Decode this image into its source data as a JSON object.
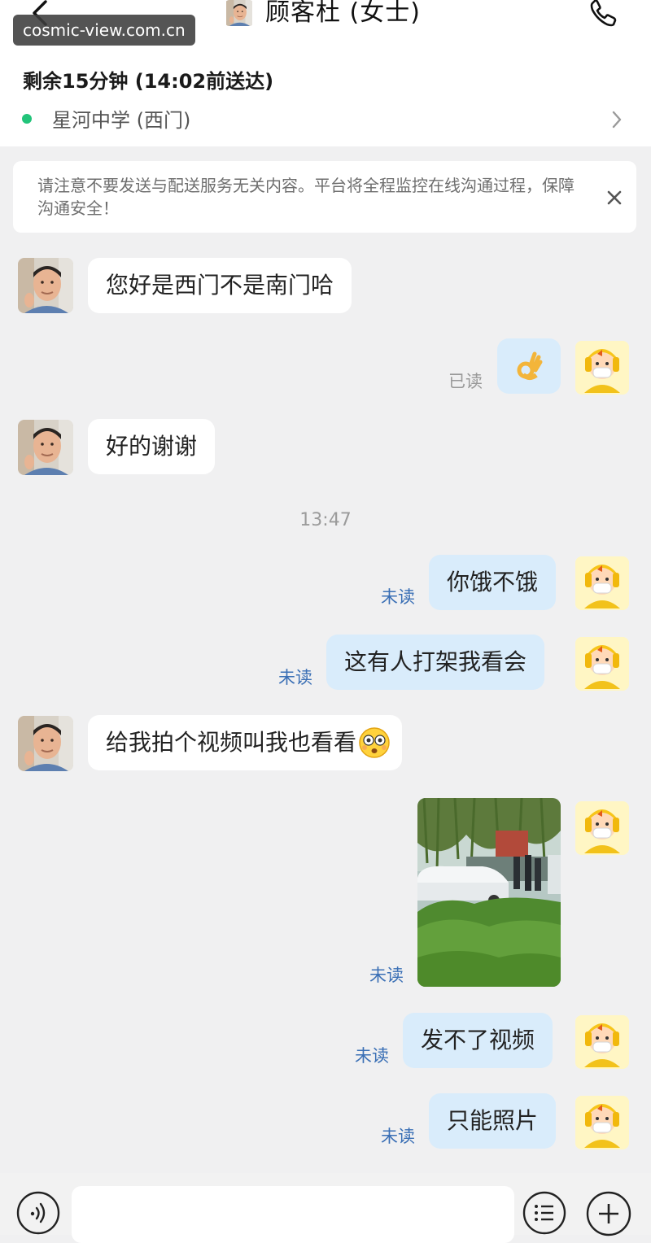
{
  "watermark": "cosmic-view.com.cn",
  "header": {
    "title": "顾客杜 (女士)"
  },
  "order": {
    "delivery_info": "剩余15分钟 (14:02前送达)",
    "location": "星河中学 (西门)"
  },
  "notice": {
    "text": "请注意不要发送与配送服务无关内容。平台将全程监控在线沟通过程，保障沟通安全！"
  },
  "messages": [
    {
      "side": "in",
      "text": "您好是西门不是南门哈"
    },
    {
      "side": "out",
      "emoji": "ok-hand-emoji",
      "status": "已读"
    },
    {
      "side": "in",
      "text": "好的谢谢"
    },
    {
      "side": "out",
      "text": "你饿不饿",
      "status": "未读"
    },
    {
      "side": "out",
      "text": "这有人打架我看会",
      "status": "未读"
    },
    {
      "side": "in",
      "text": "给我拍个视频叫我也看看",
      "emoji": "flushed-face-emoji"
    },
    {
      "side": "out",
      "image": "photo-trees-car-crowd",
      "status": "未读"
    },
    {
      "side": "out",
      "text": "发不了视频",
      "status": "未读"
    },
    {
      "side": "out",
      "text": "只能照片",
      "status": "未读"
    }
  ],
  "timestamp": "13:47",
  "input": {
    "placeholder": ""
  },
  "colors": {
    "online_dot": "#22c47a",
    "bubble_out": "#d9ecfb",
    "unread_text": "#3a6fb5",
    "read_text": "#999999"
  }
}
